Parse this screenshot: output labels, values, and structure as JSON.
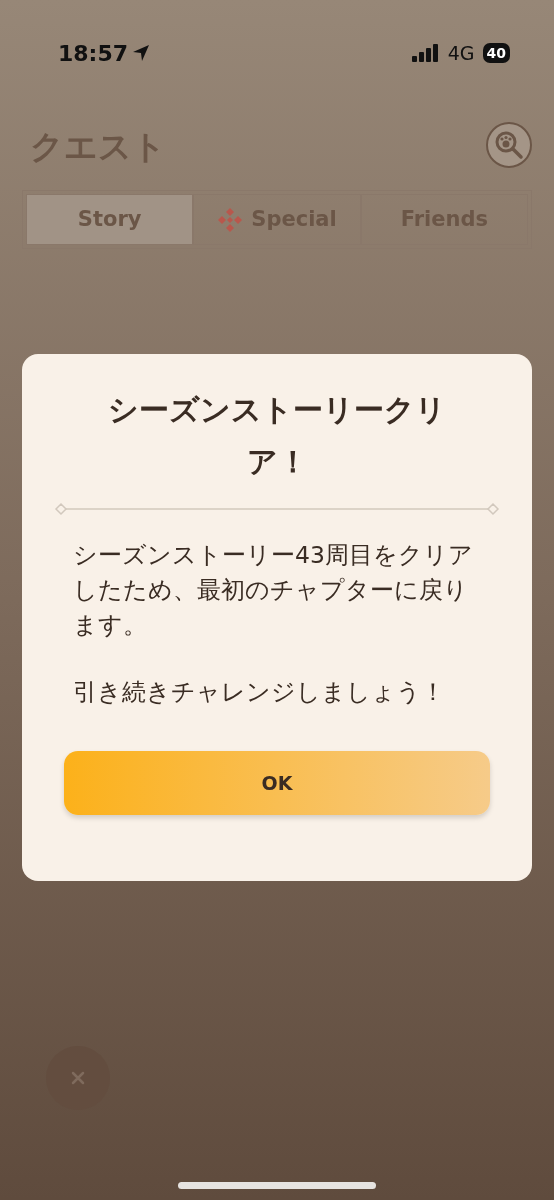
{
  "status_bar": {
    "time": "18:57",
    "network": "4G",
    "battery": "40"
  },
  "header": {
    "title": "クエスト"
  },
  "tabs": [
    {
      "label": "Story",
      "selected": true,
      "kind": "plain"
    },
    {
      "label": "Special",
      "selected": false,
      "kind": "icon"
    },
    {
      "label": "Friends",
      "selected": false,
      "kind": "plain"
    }
  ],
  "dialog": {
    "title": "シーズンストーリークリア！",
    "paragraphs": [
      "シーズンストーリー43周目をクリアしたため、最初のチャプターに戻ります。",
      "引き続きチャレンジしましょう！"
    ],
    "button": "OK"
  }
}
